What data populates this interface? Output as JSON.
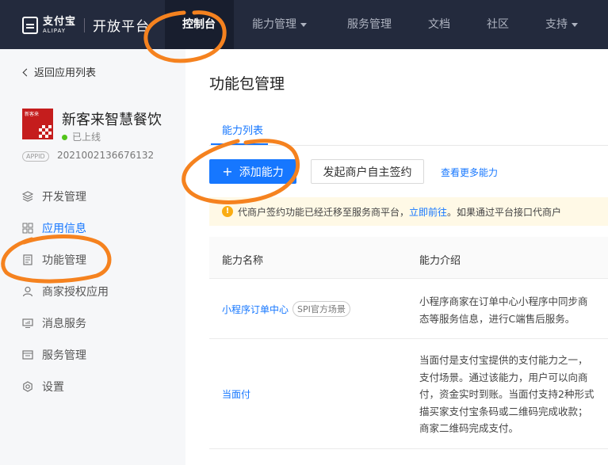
{
  "nav": {
    "brand_cn": "支付宝",
    "brand_en": "ALIPAY",
    "platform_title": "开放平台",
    "items": [
      {
        "label": "控制台"
      },
      {
        "label": "能力管理"
      },
      {
        "label": "服务管理"
      },
      {
        "label": "文档"
      },
      {
        "label": "社区"
      },
      {
        "label": "支持"
      }
    ]
  },
  "sidebar": {
    "back_label": "返回应用列表",
    "app": {
      "name": "新客来智慧餐饮",
      "status": "已上线",
      "appid_badge": "APPID",
      "appid": "2021002136676132",
      "logo_text": "新客来"
    },
    "items": [
      {
        "label": "开发管理",
        "icon": "layers-icon"
      },
      {
        "label": "应用信息",
        "icon": "grid-icon"
      },
      {
        "label": "功能管理",
        "icon": "document-icon"
      },
      {
        "label": "商家授权应用",
        "icon": "user-icon"
      },
      {
        "label": "消息服务",
        "icon": "monitor-icon"
      },
      {
        "label": "服务管理",
        "icon": "service-icon"
      },
      {
        "label": "设置",
        "icon": "gear-icon"
      }
    ],
    "active_index": 1
  },
  "main": {
    "title": "功能包管理",
    "tab": "能力列表",
    "add_button": "添加能力",
    "sign_button": "发起商户自主签约",
    "more_link": "查看更多能力",
    "notice": {
      "text_before": "代商户签约功能已经迁移至服务商平台，",
      "link": "立即前往",
      "text_after": "。如果通过平台接口代商户"
    },
    "table": {
      "col_name": "能力名称",
      "col_desc": "能力介绍",
      "rows": [
        {
          "name": "小程序订单中心",
          "tag": "SPI官方场景",
          "desc": [
            "小程序商家在订单中心小程序中同步商",
            "态等服务信息，进行C端售后服务。"
          ]
        },
        {
          "name": "当面付",
          "tag": "",
          "desc": [
            "当面付是支付宝提供的支付能力之一，",
            "支付场景。通过该能力，用户可以向商",
            "付，资金实时到账。当面付支持2种形式",
            "描买家支付宝条码或二维码完成收款；",
            "商家二维码完成支付。"
          ]
        }
      ]
    }
  },
  "colors": {
    "nav_bg": "#232a3d",
    "accent": "#1677ff",
    "annotation": "#f5821f"
  }
}
